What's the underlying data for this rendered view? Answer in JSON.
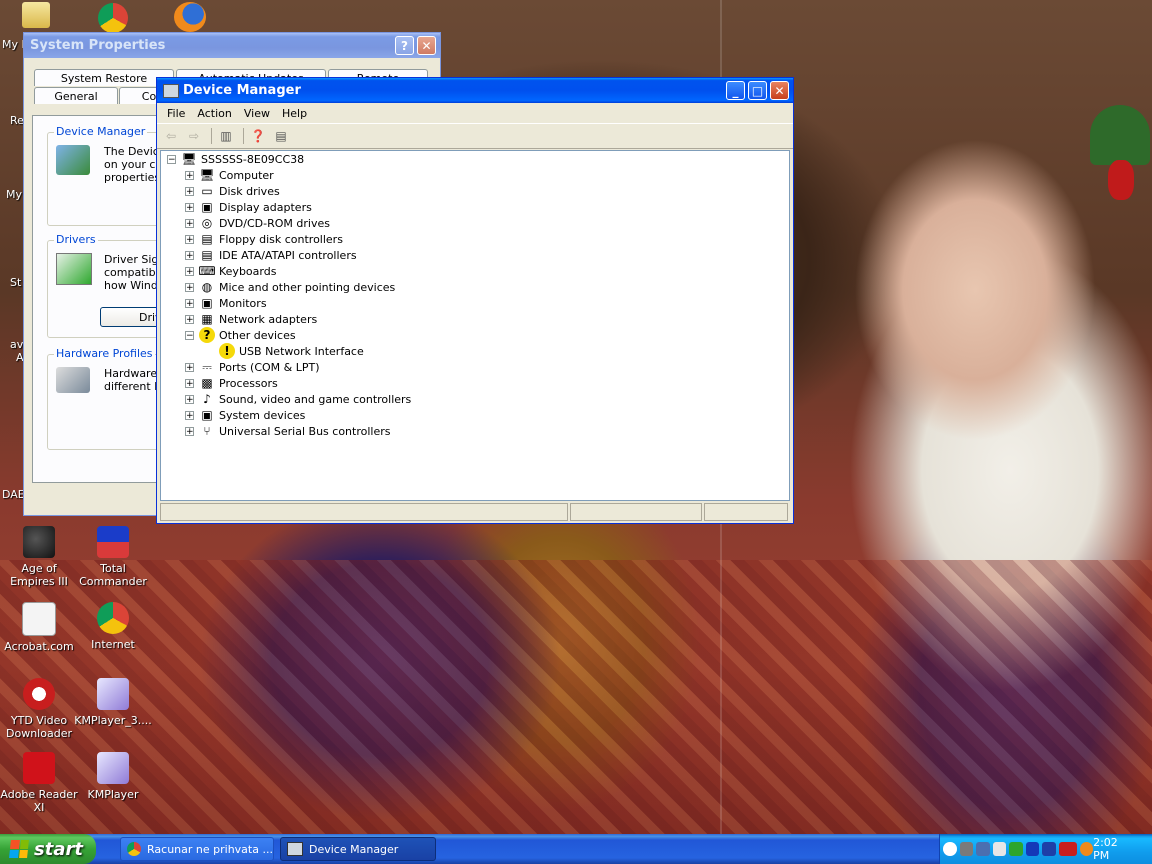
{
  "desktop": {
    "icons": [
      {
        "label": "Age of Empires III"
      },
      {
        "label": "Total Commander"
      },
      {
        "label": "Acrobat.com"
      },
      {
        "label": "Internet"
      },
      {
        "label": "YTD Video Downloader"
      },
      {
        "label": "KMPlayer_3...."
      },
      {
        "label": "Adobe Reader XI"
      },
      {
        "label": "KMPlayer"
      }
    ],
    "partial_labels": [
      "My D",
      "Re",
      "My",
      "St",
      "av",
      "A",
      "DAE"
    ]
  },
  "system_properties": {
    "title": "System Properties",
    "tabs_row1": [
      "System Restore",
      "Automatic Updates",
      "Remote"
    ],
    "tabs_row2": [
      "General",
      "Co"
    ],
    "groups": {
      "device_manager": {
        "label": "Device Manager",
        "text": [
          "The Device",
          "on your co",
          "properties o"
        ]
      },
      "drivers": {
        "label": "Drivers",
        "text": [
          "Driver Sign",
          "compatible",
          "how Windo"
        ],
        "button": "Driv"
      },
      "hardware_profiles": {
        "label": "Hardware Profiles",
        "text": [
          "Hardware p",
          "different ha"
        ]
      }
    }
  },
  "device_manager": {
    "title": "Device Manager",
    "menu": [
      "File",
      "Action",
      "View",
      "Help"
    ],
    "root": "SSSSSS-8E09CC38",
    "categories": [
      {
        "label": "Computer",
        "icon": "computer-icon",
        "expanded": false
      },
      {
        "label": "Disk drives",
        "icon": "disk-icon",
        "expanded": false
      },
      {
        "label": "Display adapters",
        "icon": "monitor-icon",
        "expanded": false
      },
      {
        "label": "DVD/CD-ROM drives",
        "icon": "cdrom-icon",
        "expanded": false
      },
      {
        "label": "Floppy disk controllers",
        "icon": "controller-icon",
        "expanded": false
      },
      {
        "label": "IDE ATA/ATAPI controllers",
        "icon": "controller-icon",
        "expanded": false
      },
      {
        "label": "Keyboards",
        "icon": "keyboard-icon",
        "expanded": false
      },
      {
        "label": "Mice and other pointing devices",
        "icon": "mouse-icon",
        "expanded": false
      },
      {
        "label": "Monitors",
        "icon": "monitor-icon",
        "expanded": false
      },
      {
        "label": "Network adapters",
        "icon": "network-icon",
        "expanded": false
      },
      {
        "label": "Other devices",
        "icon": "unknown-device-icon",
        "expanded": true
      },
      {
        "label": "Ports (COM & LPT)",
        "icon": "port-icon",
        "expanded": false
      },
      {
        "label": "Processors",
        "icon": "processor-icon",
        "expanded": false
      },
      {
        "label": "Sound, video and game controllers",
        "icon": "sound-icon",
        "expanded": false
      },
      {
        "label": "System devices",
        "icon": "system-icon",
        "expanded": false
      },
      {
        "label": "Universal Serial Bus controllers",
        "icon": "usb-icon",
        "expanded": false
      }
    ],
    "other_devices_child": "USB Network Interface"
  },
  "taskbar": {
    "start": "start",
    "items": [
      {
        "label": "Racunar ne prihvata ...",
        "active": false
      },
      {
        "label": "Device Manager",
        "active": true
      }
    ],
    "clock": "2:02 PM"
  },
  "colors": {
    "xp_blue": "#0054e3",
    "start_green": "#3c9c3c",
    "group_label": "#0046d5",
    "warning_yellow": "#f5d90a"
  }
}
